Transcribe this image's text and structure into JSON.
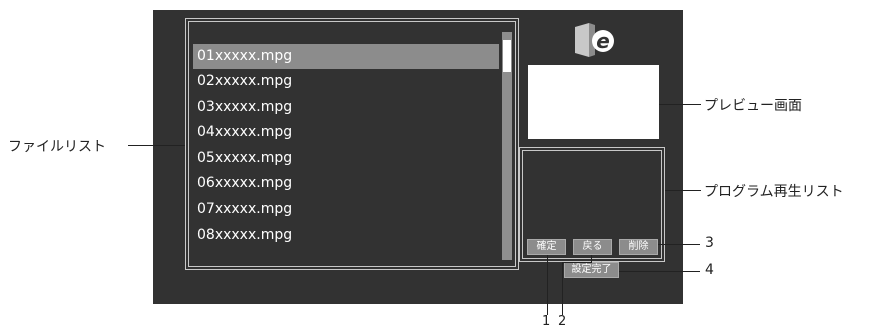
{
  "files": [
    "01xxxxx.mpg",
    "02xxxxx.mpg",
    "03xxxxx.mpg",
    "04xxxxx.mpg",
    "05xxxxx.mpg",
    "06xxxxx.mpg",
    "07xxxxx.mpg",
    "08xxxxx.mpg"
  ],
  "buttons": {
    "confirm": "確定",
    "back": "戻る",
    "delete": "削除",
    "setup_done": "設定完了"
  },
  "callouts": {
    "file_list": "ファイルリスト",
    "preview": "プレビュー画面",
    "playlist": "プログラム再生リスト",
    "num1": "1",
    "num2": "2",
    "num3": "3",
    "num4": "4"
  },
  "colors": {
    "screen_bg": "#323232",
    "selected_row": "#8c8c8c",
    "button": "#8c8c8c"
  }
}
